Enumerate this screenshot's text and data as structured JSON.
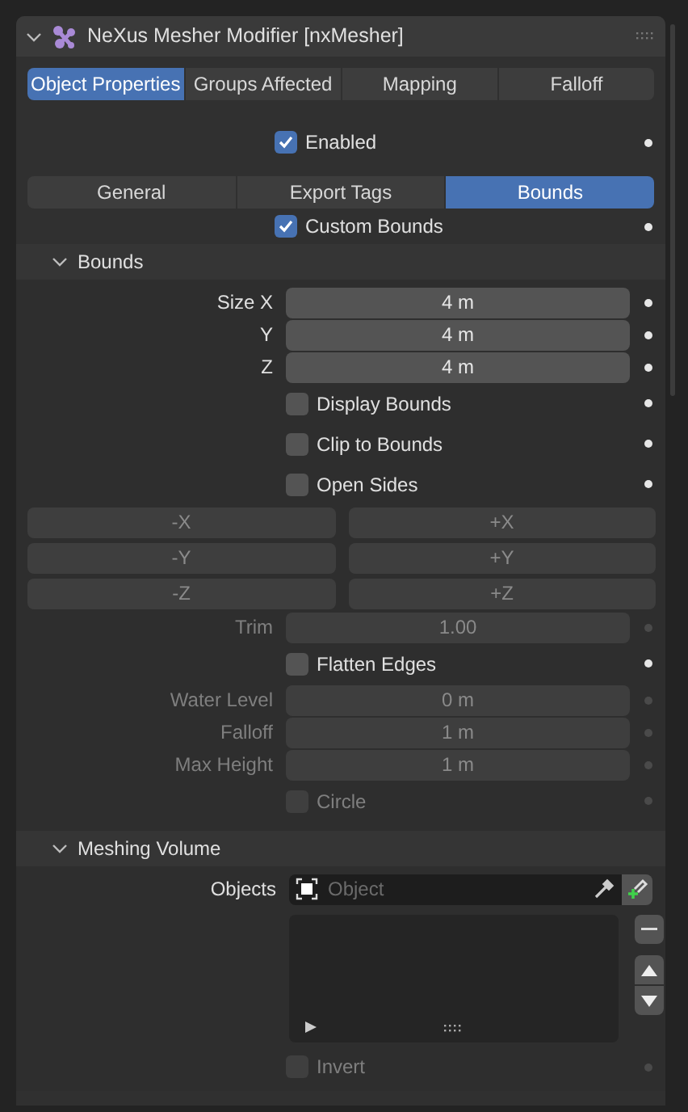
{
  "header": {
    "title": "NeXus Mesher Modifier [nxMesher]",
    "expanded": true
  },
  "main_tabs": [
    {
      "label": "Object Properties",
      "selected": true
    },
    {
      "label": "Groups Affected",
      "selected": false
    },
    {
      "label": "Mapping",
      "selected": false
    },
    {
      "label": "Falloff",
      "selected": false
    }
  ],
  "enabled": {
    "label": "Enabled",
    "checked": true
  },
  "sub_tabs": [
    {
      "label": "General",
      "selected": false
    },
    {
      "label": "Export Tags",
      "selected": false
    },
    {
      "label": "Bounds",
      "selected": true
    }
  ],
  "custom_bounds": {
    "label": "Custom Bounds",
    "checked": true
  },
  "bounds_section": {
    "title": "Bounds",
    "expanded": true,
    "rows": [
      {
        "kind": "number",
        "label": "Size X",
        "value": "4 m",
        "disabled": false
      },
      {
        "kind": "number",
        "label": "Y",
        "value": "4 m",
        "disabled": false
      },
      {
        "kind": "number",
        "label": "Z",
        "value": "4 m",
        "disabled": false
      },
      {
        "kind": "checkbox",
        "label": "Display Bounds",
        "checked": false,
        "disabled": false
      },
      {
        "kind": "checkbox",
        "label": "Clip to Bounds",
        "checked": false,
        "disabled": false
      },
      {
        "kind": "checkbox",
        "label": "Open Sides",
        "checked": false,
        "disabled": false
      },
      {
        "kind": "button_pair",
        "buttons": [
          "-X",
          "+X"
        ],
        "disabled": true
      },
      {
        "kind": "button_pair",
        "buttons": [
          "-Y",
          "+Y"
        ],
        "disabled": true
      },
      {
        "kind": "button_pair",
        "buttons": [
          "-Z",
          "+Z"
        ],
        "disabled": true
      },
      {
        "kind": "number",
        "label": "Trim",
        "value": "1.00",
        "disabled": true
      },
      {
        "kind": "checkbox",
        "label": "Flatten Edges",
        "checked": false,
        "disabled": false
      },
      {
        "kind": "number",
        "label": "Water Level",
        "value": "0 m",
        "disabled": true
      },
      {
        "kind": "number",
        "label": "Falloff",
        "value": "1 m",
        "disabled": true
      },
      {
        "kind": "number",
        "label": "Max Height",
        "value": "1 m",
        "disabled": true
      },
      {
        "kind": "checkbox",
        "label": "Circle",
        "checked": false,
        "disabled": true
      }
    ]
  },
  "meshing_section": {
    "title": "Meshing Volume",
    "expanded": true,
    "objects_label": "Objects",
    "placeholder": "Object",
    "invert": {
      "label": "Invert",
      "checked": false,
      "disabled": true
    }
  }
}
